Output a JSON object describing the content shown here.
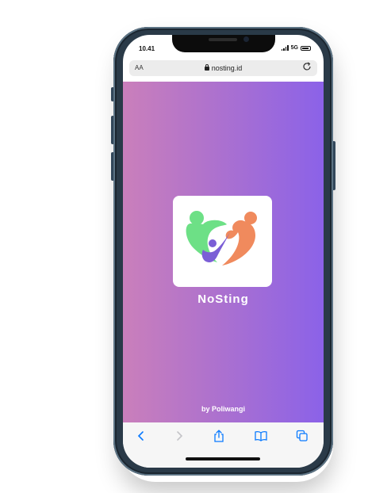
{
  "status_bar": {
    "time": "10.41",
    "network": "5G"
  },
  "browser": {
    "text_size_button": "AA",
    "url": "nosting.id"
  },
  "page": {
    "app_name": "NoSting",
    "credit": "by Poliwangi"
  },
  "toolbar": {
    "icons": [
      "back-icon",
      "forward-icon",
      "share-icon",
      "bookmarks-icon",
      "tabs-icon"
    ]
  },
  "colors": {
    "gradient_start": "#ca7fbb",
    "gradient_end": "#8b62e8",
    "logo_green": "#6de086",
    "logo_orange": "#f08a5d",
    "logo_purple": "#7b5ed6",
    "ios_blue": "#0a7aff"
  }
}
